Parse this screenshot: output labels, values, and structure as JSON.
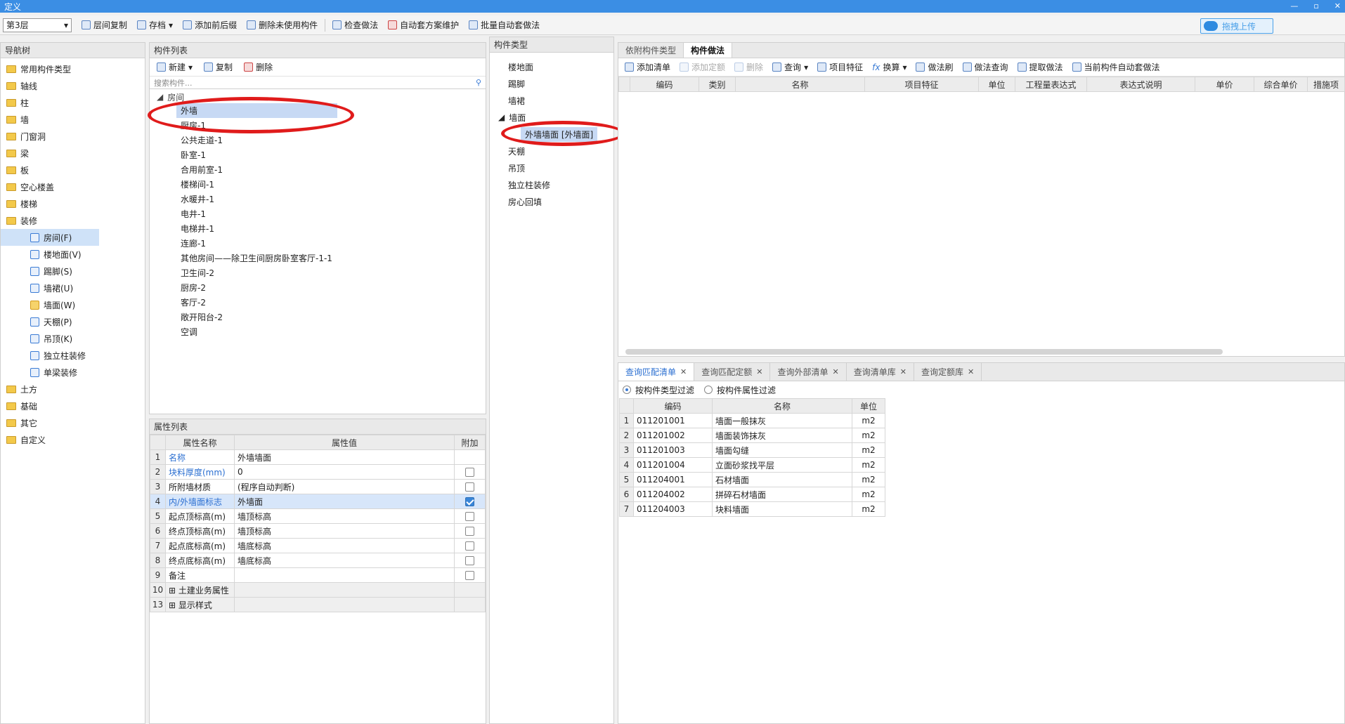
{
  "window": {
    "title": "定义",
    "controls": [
      "—",
      "▫",
      "✕"
    ]
  },
  "toolbar": {
    "floor": "第3层",
    "buttons": [
      "层间复制",
      "存档",
      "添加前后缀",
      "删除未使用构件",
      "检查做法",
      "自动套方案维护",
      "批量自动套做法"
    ],
    "upload": "拖拽上传"
  },
  "nav": {
    "title": "导航树",
    "items": [
      "常用构件类型",
      "轴线",
      "柱",
      "墙",
      "门窗洞",
      "梁",
      "板",
      "空心楼盖",
      "楼梯",
      "装修"
    ],
    "sub_items": [
      "房间(F)",
      "楼地面(V)",
      "踢脚(S)",
      "墙裙(U)",
      "墙面(W)",
      "天棚(P)",
      "吊顶(K)",
      "独立柱装修",
      "单梁装修"
    ],
    "items_after": [
      "土方",
      "基础",
      "其它",
      "自定义"
    ]
  },
  "components": {
    "title": "构件列表",
    "tools": [
      "新建",
      "复制",
      "删除"
    ],
    "search_placeholder": "搜索构件...",
    "root": "房间",
    "items": [
      "外墙",
      "厨房-1",
      "公共走道-1",
      "卧室-1",
      "合用前室-1",
      "楼梯间-1",
      "水暖井-1",
      "电井-1",
      "电梯井-1",
      "连廊-1",
      "其他房间——除卫生间厨房卧室客厅-1-1",
      "卫生间-2",
      "厨房-2",
      "客厅-2",
      "敞开阳台-2",
      "空调"
    ]
  },
  "properties": {
    "title": "属性列表",
    "headers": [
      "属性名称",
      "属性值",
      "附加"
    ],
    "rows": [
      {
        "n": "1",
        "name": "名称",
        "value": "外墙墙面"
      },
      {
        "n": "2",
        "name": "块料厚度(mm)",
        "value": "0"
      },
      {
        "n": "3",
        "name": "所附墙材质",
        "value": "(程序自动判断)"
      },
      {
        "n": "4",
        "name": "内/外墙面标志",
        "value": "外墙面"
      },
      {
        "n": "5",
        "name": "起点顶标高(m)",
        "value": "墙顶标高"
      },
      {
        "n": "6",
        "name": "终点顶标高(m)",
        "value": "墙顶标高"
      },
      {
        "n": "7",
        "name": "起点底标高(m)",
        "value": "墙底标高"
      },
      {
        "n": "8",
        "name": "终点底标高(m)",
        "value": "墙底标高"
      },
      {
        "n": "9",
        "name": "备注",
        "value": ""
      },
      {
        "n": "10",
        "name": "土建业务属性",
        "value": ""
      },
      {
        "n": "13",
        "name": "显示样式",
        "value": ""
      }
    ]
  },
  "types": {
    "title": "构件类型",
    "items": [
      "楼地面",
      "踢脚",
      "墙裙"
    ],
    "root": "墙面",
    "child": "外墙墙面 [外墙面]",
    "items_after": [
      "天棚",
      "吊顶",
      "独立柱装修",
      "房心回填"
    ]
  },
  "method": {
    "tabs": [
      "依附构件类型",
      "构件做法"
    ],
    "tools": [
      "添加清单",
      "添加定额",
      "删除",
      "查询",
      "项目特征",
      "换算",
      "做法刷",
      "做法查询",
      "提取做法",
      "当前构件自动套做法"
    ],
    "headers": [
      "编码",
      "类别",
      "名称",
      "项目特征",
      "单位",
      "工程量表达式",
      "表达式说明",
      "单价",
      "综合单价",
      "措施项"
    ]
  },
  "query": {
    "tabs": [
      "查询匹配清单",
      "查询匹配定额",
      "查询外部清单",
      "查询清单库",
      "查询定额库"
    ],
    "filter_type": "按构件类型过滤",
    "filter_attr": "按构件属性过滤",
    "headers": [
      "编码",
      "名称",
      "单位"
    ],
    "rows": [
      {
        "n": "1",
        "code": "011201001",
        "name": "墙面一般抹灰",
        "unit": "m2"
      },
      {
        "n": "2",
        "code": "011201002",
        "name": "墙面装饰抹灰",
        "unit": "m2"
      },
      {
        "n": "3",
        "code": "011201003",
        "name": "墙面勾缝",
        "unit": "m2"
      },
      {
        "n": "4",
        "code": "011201004",
        "name": "立面砂浆找平层",
        "unit": "m2"
      },
      {
        "n": "5",
        "code": "011204001",
        "name": "石材墙面",
        "unit": "m2"
      },
      {
        "n": "6",
        "code": "011204002",
        "name": "拼碎石材墙面",
        "unit": "m2"
      },
      {
        "n": "7",
        "code": "011204003",
        "name": "块料墙面",
        "unit": "m2"
      }
    ]
  }
}
